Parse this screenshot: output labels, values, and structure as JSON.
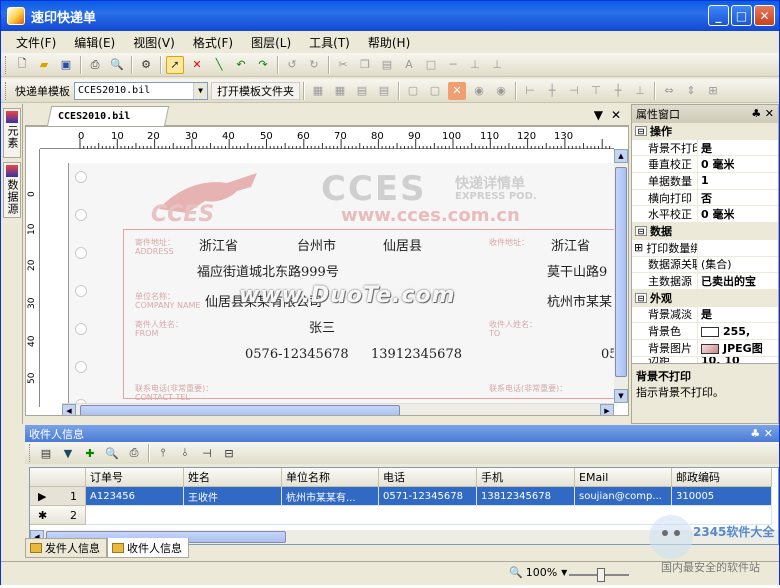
{
  "window": {
    "title": "速印快递单",
    "buttons": {
      "min": "_",
      "max": "□",
      "close": "✕"
    }
  },
  "menu": [
    "文件(F)",
    "编辑(E)",
    "视图(V)",
    "格式(F)",
    "图层(L)",
    "工具(T)",
    "帮助(H)"
  ],
  "toolbar2": {
    "template_label": "快递单模板",
    "template_value": "CCES2010.bil",
    "open_folder": "打开模板文件夹"
  },
  "left_tabs": [
    "元素",
    "数据源"
  ],
  "doc": {
    "tab": "CCES2010.bil",
    "pin": "▼",
    "close": "✕"
  },
  "ruler": {
    "h": [
      "0",
      "10",
      "20",
      "30",
      "40",
      "50",
      "60",
      "70",
      "80",
      "90",
      "100",
      "110",
      "120",
      "130"
    ],
    "v": [
      "0",
      "10",
      "20",
      "30",
      "40",
      "50"
    ]
  },
  "paper": {
    "logo_main": "CCES",
    "logo_cn": "快递详情单",
    "logo_en": "EXPRESS POD.",
    "url": "www.cces.com.cn",
    "watermark": "www.DuoTe.com",
    "sender_prov": "浙江省",
    "sender_city": "台州市",
    "sender_county": "仙居县",
    "sender_street": "福应街道城北东路999号",
    "sender_company": "仙居县某某有限公司",
    "sender_name": "张三",
    "sender_tel": "0576-12345678",
    "sender_mobile": "13912345678",
    "recv_prov": "浙江省",
    "recv_street": "莫干山路9",
    "recv_company": "杭州市某某",
    "recv_tel": "05",
    "labels": {
      "addr": "寄件地址：",
      "addr_en": "ADDRESS",
      "company": "单位名称：",
      "company_en": "COMPANY NAME",
      "sender": "寄件人姓名：",
      "sender_en": "FROM",
      "tel": "联系电话(非常重要)：",
      "tel_en": "CONTACT TEL",
      "recv": "收件人姓名：",
      "recv_en": "TO",
      "recv_addr": "收件地址："
    }
  },
  "props": {
    "title": "属性窗口",
    "pin": "♣",
    "close": "✕",
    "categories": [
      {
        "name": "操作",
        "rows": [
          [
            "背景不打印",
            "是"
          ],
          [
            "垂直校正",
            "0 毫米"
          ],
          [
            "单据数量",
            "1"
          ],
          [
            "横向打印",
            "否"
          ],
          [
            "水平校正",
            "0 毫米"
          ]
        ]
      },
      {
        "name": "数据",
        "rows": [
          [
            "打印数量绑定",
            ""
          ],
          [
            "数据源关联",
            "(集合)"
          ],
          [
            "主数据源",
            "已卖出的宝"
          ]
        ]
      },
      {
        "name": "外观",
        "rows": [
          [
            "背景减淡",
            "是"
          ],
          [
            "背景色",
            "255,"
          ],
          [
            "背景图片",
            "JPEG图"
          ],
          [
            "边距",
            "10, 10"
          ]
        ]
      }
    ],
    "desc_title": "背景不打印",
    "desc_text": "指示背景不打印。"
  },
  "bottom": {
    "title": "收件人信息",
    "pin": "♣",
    "close": "✕",
    "columns": [
      "订单号",
      "姓名",
      "单位名称",
      "电话",
      "手机",
      "EMail",
      "邮政编码"
    ],
    "rows": [
      [
        "A123456",
        "王收件",
        "杭州市某某有...",
        "0571-12345678",
        "13812345678",
        "soujian@comp...",
        "310005"
      ]
    ],
    "row_nums": [
      "1",
      "2"
    ],
    "tabs": [
      "发件人信息",
      "收件人信息"
    ]
  },
  "status": {
    "zoom": "100%"
  },
  "badge": {
    "brand": "2345软件大全",
    "sub": "国内最安全的软件站"
  }
}
